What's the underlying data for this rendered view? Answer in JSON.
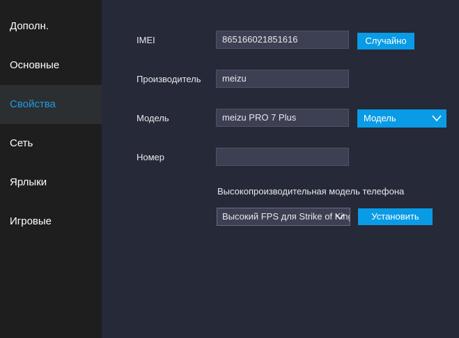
{
  "sidebar": {
    "items": [
      {
        "label": "Дополн."
      },
      {
        "label": "Основные"
      },
      {
        "label": "Свойства"
      },
      {
        "label": "Сеть"
      },
      {
        "label": "Ярлыки"
      },
      {
        "label": "Игровые"
      }
    ],
    "active_index": 2
  },
  "properties": {
    "imei_label": "IMEI",
    "imei_value": "865166021851616",
    "random_button": "Случайно",
    "manufacturer_label": "Производитель",
    "manufacturer_value": "meizu",
    "model_label": "Модель",
    "model_value": "meizu PRO 7 Plus",
    "model_select": "Модель",
    "number_label": "Номер",
    "number_value": "",
    "hp_model_label": "Высокопроизводительная модель телефона",
    "hp_model_select": "Высокий FPS для Strike of Kings",
    "install_button": "Установить"
  },
  "colors": {
    "accent": "#0a9be6",
    "active_nav_text": "#1d9ce5",
    "sidebar_bg": "#1e1e1e",
    "content_bg": "#262937",
    "field_bg": "#3d3f52"
  },
  "icons": {
    "model_select_arrow": "chevron-down-icon",
    "hp_select_arrow": "chevron-down-icon"
  }
}
